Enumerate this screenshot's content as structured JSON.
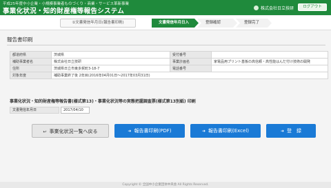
{
  "header": {
    "subtitle": "平成25年度中小企業・小規模事業者ものづくり・商業・サービス革新事業",
    "title": "事業化状況・知的財産権等報告システム",
    "user": "株式会社日立技研",
    "logout_label": "ログアウト"
  },
  "steps": {
    "date_step": "①文書発信年月日(報告書印刷)",
    "items": [
      "文書発信年月日入力",
      "登録確認",
      "登録完了"
    ],
    "active_index": 0
  },
  "page_title": "報告書印刷",
  "info_table": {
    "rows": [
      {
        "label1": "都道府県",
        "value1": "茨城県",
        "label2": "受付番号",
        "value2": ""
      },
      {
        "label1": "補助事業者名",
        "value1": "株式会社日立技研",
        "label2": "事業計画名",
        "value2": "家電品用プリント基板の高信頼・高性能はんだ付け技術の開発"
      },
      {
        "label1": "住所",
        "value1": "茨城県日立市東多賀町3-18-7",
        "label2": "電話番号",
        "value2": ""
      },
      {
        "label1": "対象年度",
        "value1": "補助事業終了後 2年目(2016年04月01日～2017年03月31日)",
        "label2": "",
        "value2": ""
      }
    ]
  },
  "section_title": "事業化状況・知的財産権等報告書(様式第13)・事業化状況等の実態把握調査票(様式第13別紙) 印刷",
  "date_field": {
    "label": "文書発信年月日",
    "value": "2017/04/10"
  },
  "buttons": {
    "back": "事業化状況一覧へ戻る",
    "pdf": "報告書印刷(PDF)",
    "excel": "報告書印刷(Excel)",
    "register": "登　録"
  },
  "footer": "Copyright © 全国中小企業団体中央会 All Rights Reserved.",
  "colors": {
    "header_green": "#1f8a3c",
    "button_blue": "#1a7ad6"
  }
}
